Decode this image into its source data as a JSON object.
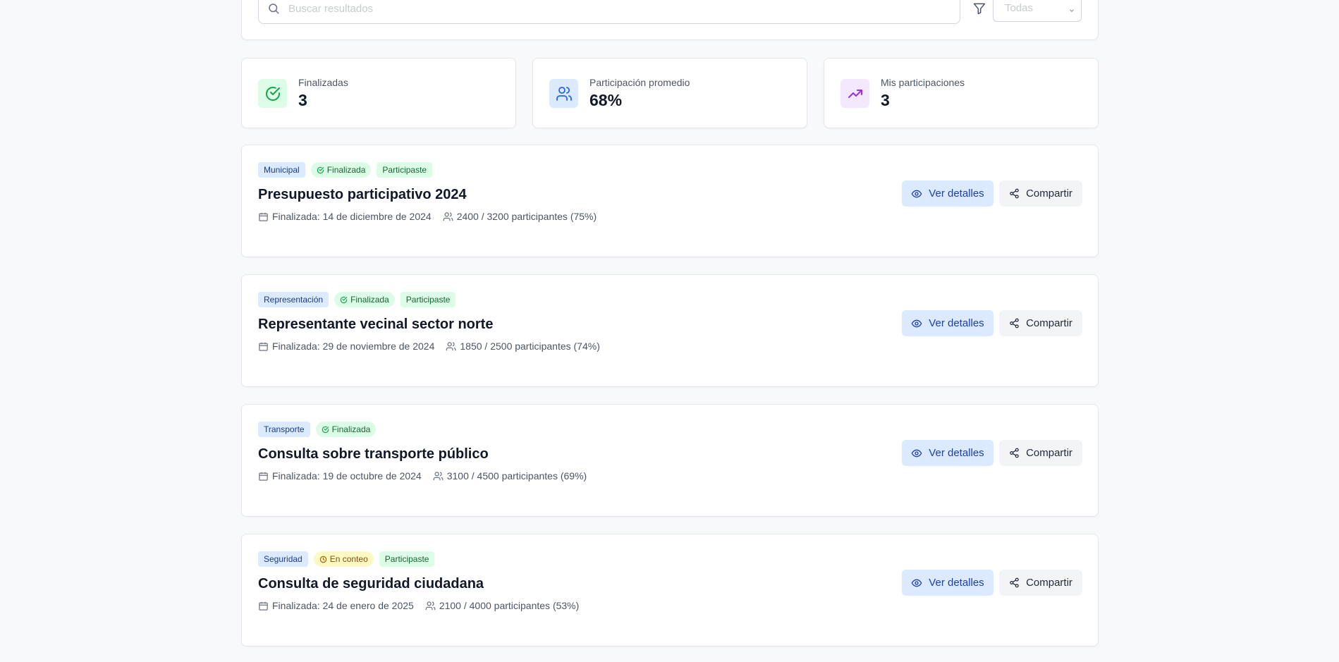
{
  "search": {
    "placeholder": "Buscar resultados",
    "value": ""
  },
  "filter": {
    "selected": "Todas"
  },
  "stats": [
    {
      "label": "Finalizadas",
      "value": "3",
      "icon": "check-circle-icon",
      "bg": "#dcfce7",
      "color": "#16a34a"
    },
    {
      "label": "Participación promedio",
      "value": "68%",
      "icon": "users-icon",
      "bg": "#dbeafe",
      "color": "#2563eb"
    },
    {
      "label": "Mis participaciones",
      "value": "3",
      "icon": "trending-up-icon",
      "bg": "#f3e8ff",
      "color": "#9333ea"
    }
  ],
  "actions": {
    "view_label": "Ver detalles",
    "share_label": "Compartir"
  },
  "results": [
    {
      "category": "Municipal",
      "status": "Finalizada",
      "participated": "Participaste",
      "title": "Presupuesto participativo 2024",
      "date": "Finalizada: 14 de diciembre de 2024",
      "participants": "2400 / 3200 participantes (75%)"
    },
    {
      "category": "Representación",
      "status": "Finalizada",
      "participated": "Participaste",
      "title": "Representante vecinal sector norte",
      "date": "Finalizada: 29 de noviembre de 2024",
      "participants": "1850 / 2500 participantes (74%)"
    },
    {
      "category": "Transporte",
      "status": "Finalizada",
      "participated": "",
      "title": "Consulta sobre transporte público",
      "date": "Finalizada: 19 de octubre de 2024",
      "participants": "3100 / 4500 participantes (69%)"
    },
    {
      "category": "Seguridad",
      "status": "En conteo",
      "participated": "Participaste",
      "title": "Consulta de seguridad ciudadana",
      "date": "Finalizada: 24 de enero de 2025",
      "participants": "2100 / 4000 participantes (53%)"
    }
  ]
}
